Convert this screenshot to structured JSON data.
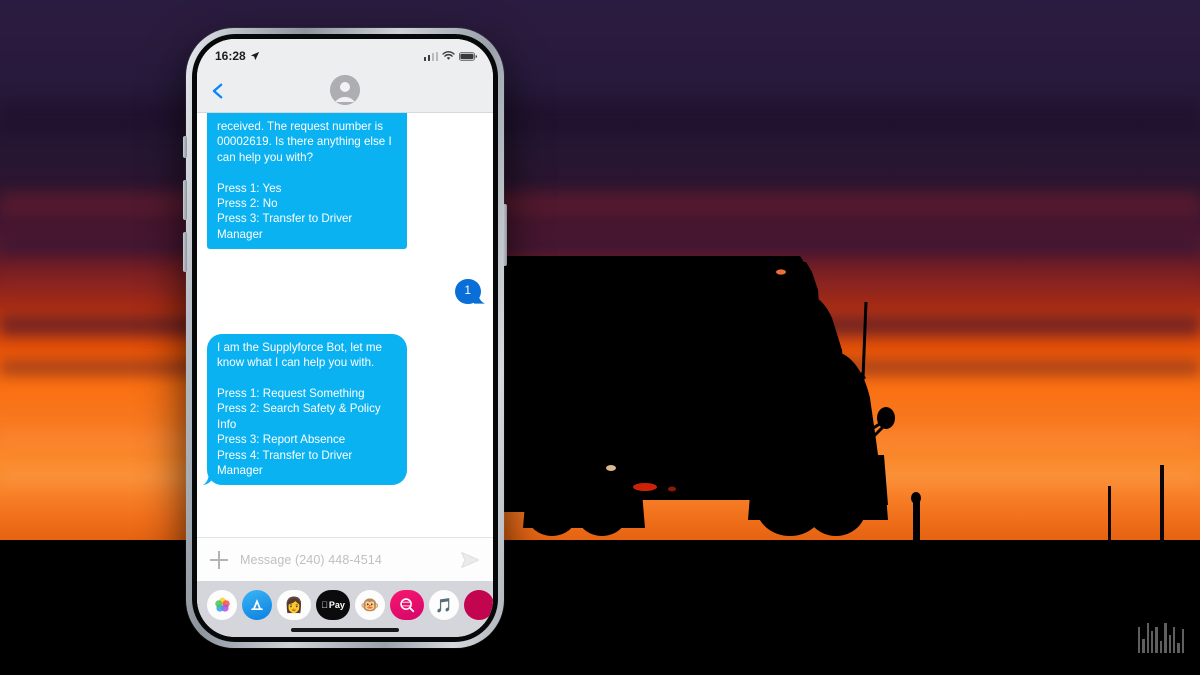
{
  "scene": {
    "description": "Sunset silhouette of a semi truck behind a smartphone showing an SMS chatbot conversation",
    "sky_top_color": "#2a1c40",
    "sky_horizon_color": "#fb8b2c",
    "ground_color": "#000000",
    "truck_color": "#000000",
    "watermark_name": "barcode-watermark",
    "watermark_bars": [
      26,
      14,
      30,
      22,
      26,
      12,
      30,
      18,
      26,
      10,
      24
    ]
  },
  "phone": {
    "status_bar": {
      "time": "16:28",
      "location_icon": "location-arrow-icon",
      "signal_icon": "cellular-signal-icon",
      "signal_bars": 4,
      "signal_active_bars": 2,
      "wifi_icon": "wifi-icon",
      "battery_icon": "battery-full-icon"
    },
    "nav_bar": {
      "back_icon": "chevron-left-icon",
      "avatar_icon": "contact-avatar-icon",
      "contact_name": ""
    },
    "conversation": {
      "messages": [
        {
          "direction": "incoming",
          "partial": true,
          "text": "received. The request number is 00002619. Is there anything else I can help you with?\n\nPress 1: Yes\nPress 2: No\nPress 3: Transfer to Driver Manager",
          "bubble_color": "#0ab2f2"
        },
        {
          "direction": "outgoing",
          "partial": false,
          "text": "1",
          "bubble_color": "#0a6ed8"
        },
        {
          "direction": "incoming",
          "partial": false,
          "text": "I am the Supplyforce Bot, let me know what I can help you with.\n\nPress 1: Request Something\nPress 2: Search Safety & Policy Info\nPress 3: Report Absence\nPress 4: Transfer to Driver Manager",
          "bubble_color": "#0ab2f2"
        }
      ]
    },
    "input_bar": {
      "plus_icon": "plus-icon",
      "placeholder": "Message (240) 448-4514",
      "value": "",
      "send_icon": "send-arrow-icon"
    },
    "app_dock": {
      "apps": [
        {
          "name": "photos-app-icon",
          "label": ""
        },
        {
          "name": "app-store-app-icon",
          "label": "A"
        },
        {
          "name": "memoji-app-icon",
          "label": "👩"
        },
        {
          "name": "apple-pay-app-icon",
          "label": "Pay"
        },
        {
          "name": "animoji-app-icon",
          "label": "🐵"
        },
        {
          "name": "images-app-icon",
          "label": ""
        },
        {
          "name": "music-app-icon",
          "label": "🎵"
        },
        {
          "name": "more-apps-icon",
          "label": ""
        }
      ],
      "home_indicator": "home-indicator"
    }
  }
}
